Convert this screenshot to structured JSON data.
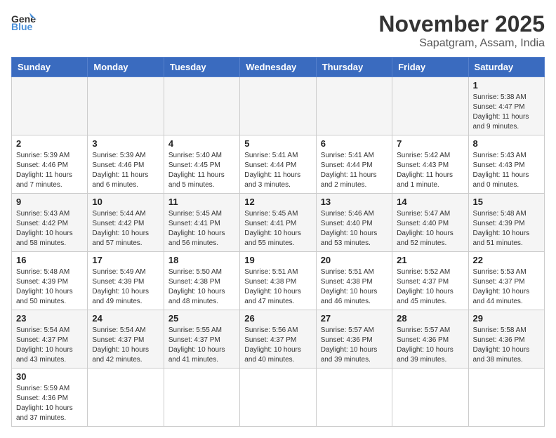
{
  "header": {
    "logo_general": "General",
    "logo_blue": "Blue",
    "month": "November 2025",
    "location": "Sapatgram, Assam, India"
  },
  "weekdays": [
    "Sunday",
    "Monday",
    "Tuesday",
    "Wednesday",
    "Thursday",
    "Friday",
    "Saturday"
  ],
  "rows": [
    [
      {
        "day": "",
        "info": ""
      },
      {
        "day": "",
        "info": ""
      },
      {
        "day": "",
        "info": ""
      },
      {
        "day": "",
        "info": ""
      },
      {
        "day": "",
        "info": ""
      },
      {
        "day": "",
        "info": ""
      },
      {
        "day": "1",
        "info": "Sunrise: 5:38 AM\nSunset: 4:47 PM\nDaylight: 11 hours and 9 minutes."
      }
    ],
    [
      {
        "day": "2",
        "info": "Sunrise: 5:39 AM\nSunset: 4:46 PM\nDaylight: 11 hours and 7 minutes."
      },
      {
        "day": "3",
        "info": "Sunrise: 5:39 AM\nSunset: 4:46 PM\nDaylight: 11 hours and 6 minutes."
      },
      {
        "day": "4",
        "info": "Sunrise: 5:40 AM\nSunset: 4:45 PM\nDaylight: 11 hours and 5 minutes."
      },
      {
        "day": "5",
        "info": "Sunrise: 5:41 AM\nSunset: 4:44 PM\nDaylight: 11 hours and 3 minutes."
      },
      {
        "day": "6",
        "info": "Sunrise: 5:41 AM\nSunset: 4:44 PM\nDaylight: 11 hours and 2 minutes."
      },
      {
        "day": "7",
        "info": "Sunrise: 5:42 AM\nSunset: 4:43 PM\nDaylight: 11 hours and 1 minute."
      },
      {
        "day": "8",
        "info": "Sunrise: 5:43 AM\nSunset: 4:43 PM\nDaylight: 11 hours and 0 minutes."
      }
    ],
    [
      {
        "day": "9",
        "info": "Sunrise: 5:43 AM\nSunset: 4:42 PM\nDaylight: 10 hours and 58 minutes."
      },
      {
        "day": "10",
        "info": "Sunrise: 5:44 AM\nSunset: 4:42 PM\nDaylight: 10 hours and 57 minutes."
      },
      {
        "day": "11",
        "info": "Sunrise: 5:45 AM\nSunset: 4:41 PM\nDaylight: 10 hours and 56 minutes."
      },
      {
        "day": "12",
        "info": "Sunrise: 5:45 AM\nSunset: 4:41 PM\nDaylight: 10 hours and 55 minutes."
      },
      {
        "day": "13",
        "info": "Sunrise: 5:46 AM\nSunset: 4:40 PM\nDaylight: 10 hours and 53 minutes."
      },
      {
        "day": "14",
        "info": "Sunrise: 5:47 AM\nSunset: 4:40 PM\nDaylight: 10 hours and 52 minutes."
      },
      {
        "day": "15",
        "info": "Sunrise: 5:48 AM\nSunset: 4:39 PM\nDaylight: 10 hours and 51 minutes."
      }
    ],
    [
      {
        "day": "16",
        "info": "Sunrise: 5:48 AM\nSunset: 4:39 PM\nDaylight: 10 hours and 50 minutes."
      },
      {
        "day": "17",
        "info": "Sunrise: 5:49 AM\nSunset: 4:39 PM\nDaylight: 10 hours and 49 minutes."
      },
      {
        "day": "18",
        "info": "Sunrise: 5:50 AM\nSunset: 4:38 PM\nDaylight: 10 hours and 48 minutes."
      },
      {
        "day": "19",
        "info": "Sunrise: 5:51 AM\nSunset: 4:38 PM\nDaylight: 10 hours and 47 minutes."
      },
      {
        "day": "20",
        "info": "Sunrise: 5:51 AM\nSunset: 4:38 PM\nDaylight: 10 hours and 46 minutes."
      },
      {
        "day": "21",
        "info": "Sunrise: 5:52 AM\nSunset: 4:37 PM\nDaylight: 10 hours and 45 minutes."
      },
      {
        "day": "22",
        "info": "Sunrise: 5:53 AM\nSunset: 4:37 PM\nDaylight: 10 hours and 44 minutes."
      }
    ],
    [
      {
        "day": "23",
        "info": "Sunrise: 5:54 AM\nSunset: 4:37 PM\nDaylight: 10 hours and 43 minutes."
      },
      {
        "day": "24",
        "info": "Sunrise: 5:54 AM\nSunset: 4:37 PM\nDaylight: 10 hours and 42 minutes."
      },
      {
        "day": "25",
        "info": "Sunrise: 5:55 AM\nSunset: 4:37 PM\nDaylight: 10 hours and 41 minutes."
      },
      {
        "day": "26",
        "info": "Sunrise: 5:56 AM\nSunset: 4:37 PM\nDaylight: 10 hours and 40 minutes."
      },
      {
        "day": "27",
        "info": "Sunrise: 5:57 AM\nSunset: 4:36 PM\nDaylight: 10 hours and 39 minutes."
      },
      {
        "day": "28",
        "info": "Sunrise: 5:57 AM\nSunset: 4:36 PM\nDaylight: 10 hours and 39 minutes."
      },
      {
        "day": "29",
        "info": "Sunrise: 5:58 AM\nSunset: 4:36 PM\nDaylight: 10 hours and 38 minutes."
      }
    ],
    [
      {
        "day": "30",
        "info": "Sunrise: 5:59 AM\nSunset: 4:36 PM\nDaylight: 10 hours and 37 minutes."
      },
      {
        "day": "",
        "info": ""
      },
      {
        "day": "",
        "info": ""
      },
      {
        "day": "",
        "info": ""
      },
      {
        "day": "",
        "info": ""
      },
      {
        "day": "",
        "info": ""
      },
      {
        "day": "",
        "info": ""
      }
    ]
  ]
}
